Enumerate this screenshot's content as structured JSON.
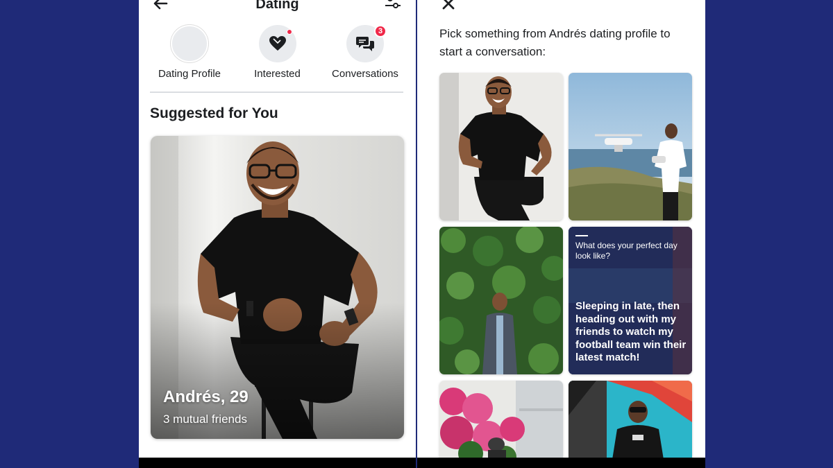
{
  "left_screen": {
    "title": "Dating",
    "shortcuts": [
      {
        "label": "Dating Profile"
      },
      {
        "label": "Interested"
      },
      {
        "label": "Conversations",
        "badge": "3"
      }
    ],
    "section_title": "Suggested for You",
    "profile_card": {
      "name_age": "Andrés, 29",
      "mutual": "3 mutual friends"
    }
  },
  "right_screen": {
    "prompt": "Pick something from Andrés dating profile to start a conversation:",
    "qa_tile": {
      "question": "What does your perfect day look like?",
      "answer": "Sleeping in late, then heading out with my friends to watch my football team win their latest match!"
    }
  },
  "colors": {
    "background": "#1f2a78",
    "badge_red": "#f02849",
    "qa_tile_bg": "#232c5c"
  },
  "icons": [
    "back-arrow-icon",
    "filter-icon",
    "heart-icon",
    "chat-bubbles-icon",
    "close-icon"
  ]
}
